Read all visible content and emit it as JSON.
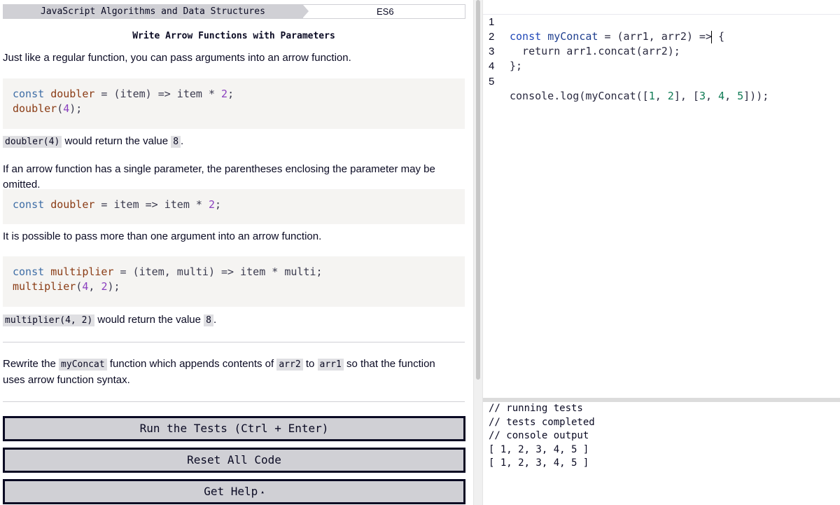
{
  "breadcrumb": {
    "superblock": "JavaScript Algorithms and Data Structures",
    "chapter": "ES6"
  },
  "challenge": {
    "title": "Write Arrow Functions with Parameters",
    "p1": "Just like a regular function, you can pass arguments into an arrow function.",
    "ex1": {
      "line1": {
        "kw": "const",
        "name": "doubler",
        "rest": " = (item) => item * ",
        "num": "2",
        "end": ";"
      },
      "line2": {
        "fn": "doubler",
        "open": "(",
        "num": "4",
        "end": ");"
      }
    },
    "p2": {
      "code": "doubler(4)",
      "text": "would return the value",
      "value": "8",
      "end": "."
    },
    "p3": "If an arrow function has a single parameter, the parentheses enclosing the parameter may be omitted.",
    "ex2": {
      "kw": "const",
      "name": "doubler",
      "rest": " = item => item * ",
      "num": "2",
      "end": ";"
    },
    "p4": "It is possible to pass more than one argument into an arrow function.",
    "ex3": {
      "line1": {
        "kw": "const",
        "name": "multiplier",
        "rest": " = (item, multi) => item * multi;"
      },
      "line2": {
        "fn": "multiplier",
        "open": "(",
        "num1": "4",
        "sep": ", ",
        "num2": "2",
        "end": ");"
      }
    },
    "p5": {
      "code": "multiplier(4, 2)",
      "text": "would return the value",
      "value": "8",
      "end": "."
    },
    "instructions": {
      "t1": "Rewrite the",
      "c1": "myConcat",
      "t2": "function which appends contents of",
      "c2": "arr2",
      "t3": "to",
      "c3": "arr1",
      "t4": "so that the function uses arrow function syntax."
    }
  },
  "buttons": {
    "run": "Run the Tests (Ctrl + Enter)",
    "reset": "Reset All Code",
    "help": "Get Help",
    "help_caret": "▴"
  },
  "editor": {
    "lines": [
      {
        "n": "1",
        "kw": "const",
        "a": " ",
        "id": "myConcat",
        "b": " = (arr1, arr2) =>",
        "c": " {"
      },
      {
        "n": "2",
        "text": "  return arr1.concat(arr2);"
      },
      {
        "n": "3",
        "text": "};"
      },
      {
        "n": "4",
        "text": ""
      },
      {
        "n": "5",
        "pre": "console.log(myConcat([",
        "n1": "1",
        "s1": ", ",
        "n2": "2",
        "s2": "], [",
        "n3": "3",
        "s3": ", ",
        "n4": "4",
        "s4": ", ",
        "n5": "5",
        "post": "]));"
      }
    ]
  },
  "console": {
    "lines": [
      "// running tests",
      "// tests completed",
      "// console output",
      "[ 1, 2, 3, 4, 5 ]",
      "[ 1, 2, 3, 4, 5 ]"
    ]
  }
}
